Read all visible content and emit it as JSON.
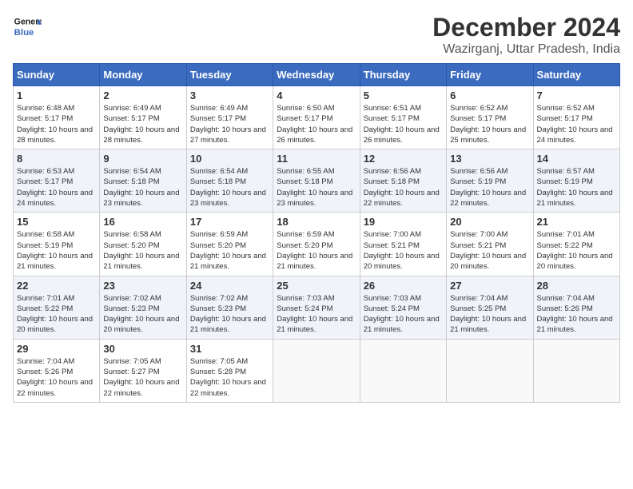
{
  "header": {
    "logo_line1": "General",
    "logo_line2": "Blue",
    "month": "December 2024",
    "location": "Wazirganj, Uttar Pradesh, India"
  },
  "weekdays": [
    "Sunday",
    "Monday",
    "Tuesday",
    "Wednesday",
    "Thursday",
    "Friday",
    "Saturday"
  ],
  "weeks": [
    [
      {
        "day": "1",
        "sunrise": "Sunrise: 6:48 AM",
        "sunset": "Sunset: 5:17 PM",
        "daylight": "Daylight: 10 hours and 28 minutes."
      },
      {
        "day": "2",
        "sunrise": "Sunrise: 6:49 AM",
        "sunset": "Sunset: 5:17 PM",
        "daylight": "Daylight: 10 hours and 28 minutes."
      },
      {
        "day": "3",
        "sunrise": "Sunrise: 6:49 AM",
        "sunset": "Sunset: 5:17 PM",
        "daylight": "Daylight: 10 hours and 27 minutes."
      },
      {
        "day": "4",
        "sunrise": "Sunrise: 6:50 AM",
        "sunset": "Sunset: 5:17 PM",
        "daylight": "Daylight: 10 hours and 26 minutes."
      },
      {
        "day": "5",
        "sunrise": "Sunrise: 6:51 AM",
        "sunset": "Sunset: 5:17 PM",
        "daylight": "Daylight: 10 hours and 26 minutes."
      },
      {
        "day": "6",
        "sunrise": "Sunrise: 6:52 AM",
        "sunset": "Sunset: 5:17 PM",
        "daylight": "Daylight: 10 hours and 25 minutes."
      },
      {
        "day": "7",
        "sunrise": "Sunrise: 6:52 AM",
        "sunset": "Sunset: 5:17 PM",
        "daylight": "Daylight: 10 hours and 24 minutes."
      }
    ],
    [
      {
        "day": "8",
        "sunrise": "Sunrise: 6:53 AM",
        "sunset": "Sunset: 5:17 PM",
        "daylight": "Daylight: 10 hours and 24 minutes."
      },
      {
        "day": "9",
        "sunrise": "Sunrise: 6:54 AM",
        "sunset": "Sunset: 5:18 PM",
        "daylight": "Daylight: 10 hours and 23 minutes."
      },
      {
        "day": "10",
        "sunrise": "Sunrise: 6:54 AM",
        "sunset": "Sunset: 5:18 PM",
        "daylight": "Daylight: 10 hours and 23 minutes."
      },
      {
        "day": "11",
        "sunrise": "Sunrise: 6:55 AM",
        "sunset": "Sunset: 5:18 PM",
        "daylight": "Daylight: 10 hours and 23 minutes."
      },
      {
        "day": "12",
        "sunrise": "Sunrise: 6:56 AM",
        "sunset": "Sunset: 5:18 PM",
        "daylight": "Daylight: 10 hours and 22 minutes."
      },
      {
        "day": "13",
        "sunrise": "Sunrise: 6:56 AM",
        "sunset": "Sunset: 5:19 PM",
        "daylight": "Daylight: 10 hours and 22 minutes."
      },
      {
        "day": "14",
        "sunrise": "Sunrise: 6:57 AM",
        "sunset": "Sunset: 5:19 PM",
        "daylight": "Daylight: 10 hours and 21 minutes."
      }
    ],
    [
      {
        "day": "15",
        "sunrise": "Sunrise: 6:58 AM",
        "sunset": "Sunset: 5:19 PM",
        "daylight": "Daylight: 10 hours and 21 minutes."
      },
      {
        "day": "16",
        "sunrise": "Sunrise: 6:58 AM",
        "sunset": "Sunset: 5:20 PM",
        "daylight": "Daylight: 10 hours and 21 minutes."
      },
      {
        "day": "17",
        "sunrise": "Sunrise: 6:59 AM",
        "sunset": "Sunset: 5:20 PM",
        "daylight": "Daylight: 10 hours and 21 minutes."
      },
      {
        "day": "18",
        "sunrise": "Sunrise: 6:59 AM",
        "sunset": "Sunset: 5:20 PM",
        "daylight": "Daylight: 10 hours and 21 minutes."
      },
      {
        "day": "19",
        "sunrise": "Sunrise: 7:00 AM",
        "sunset": "Sunset: 5:21 PM",
        "daylight": "Daylight: 10 hours and 20 minutes."
      },
      {
        "day": "20",
        "sunrise": "Sunrise: 7:00 AM",
        "sunset": "Sunset: 5:21 PM",
        "daylight": "Daylight: 10 hours and 20 minutes."
      },
      {
        "day": "21",
        "sunrise": "Sunrise: 7:01 AM",
        "sunset": "Sunset: 5:22 PM",
        "daylight": "Daylight: 10 hours and 20 minutes."
      }
    ],
    [
      {
        "day": "22",
        "sunrise": "Sunrise: 7:01 AM",
        "sunset": "Sunset: 5:22 PM",
        "daylight": "Daylight: 10 hours and 20 minutes."
      },
      {
        "day": "23",
        "sunrise": "Sunrise: 7:02 AM",
        "sunset": "Sunset: 5:23 PM",
        "daylight": "Daylight: 10 hours and 20 minutes."
      },
      {
        "day": "24",
        "sunrise": "Sunrise: 7:02 AM",
        "sunset": "Sunset: 5:23 PM",
        "daylight": "Daylight: 10 hours and 21 minutes."
      },
      {
        "day": "25",
        "sunrise": "Sunrise: 7:03 AM",
        "sunset": "Sunset: 5:24 PM",
        "daylight": "Daylight: 10 hours and 21 minutes."
      },
      {
        "day": "26",
        "sunrise": "Sunrise: 7:03 AM",
        "sunset": "Sunset: 5:24 PM",
        "daylight": "Daylight: 10 hours and 21 minutes."
      },
      {
        "day": "27",
        "sunrise": "Sunrise: 7:04 AM",
        "sunset": "Sunset: 5:25 PM",
        "daylight": "Daylight: 10 hours and 21 minutes."
      },
      {
        "day": "28",
        "sunrise": "Sunrise: 7:04 AM",
        "sunset": "Sunset: 5:26 PM",
        "daylight": "Daylight: 10 hours and 21 minutes."
      }
    ],
    [
      {
        "day": "29",
        "sunrise": "Sunrise: 7:04 AM",
        "sunset": "Sunset: 5:26 PM",
        "daylight": "Daylight: 10 hours and 22 minutes."
      },
      {
        "day": "30",
        "sunrise": "Sunrise: 7:05 AM",
        "sunset": "Sunset: 5:27 PM",
        "daylight": "Daylight: 10 hours and 22 minutes."
      },
      {
        "day": "31",
        "sunrise": "Sunrise: 7:05 AM",
        "sunset": "Sunset: 5:28 PM",
        "daylight": "Daylight: 10 hours and 22 minutes."
      },
      null,
      null,
      null,
      null
    ]
  ]
}
